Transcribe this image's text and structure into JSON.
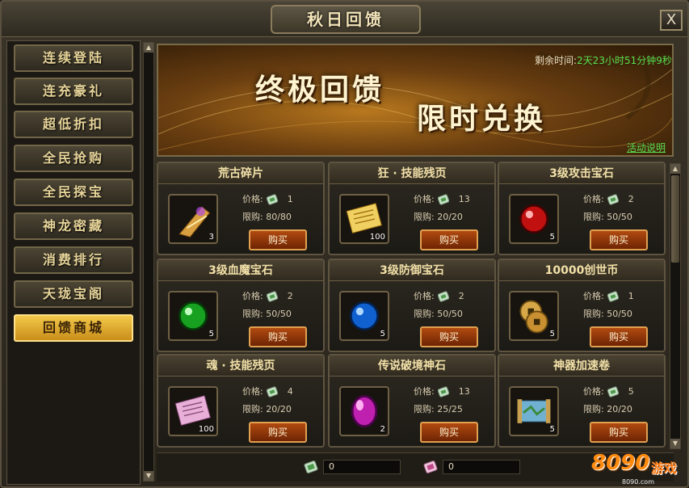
{
  "window": {
    "title": "秋日回馈",
    "close_label": "X"
  },
  "sidebar": {
    "items": [
      {
        "label": "连续登陆",
        "active": false
      },
      {
        "label": "连充豪礼",
        "active": false
      },
      {
        "label": "超低折扣",
        "active": false
      },
      {
        "label": "全民抢购",
        "active": false
      },
      {
        "label": "全民探宝",
        "active": false
      },
      {
        "label": "神龙密藏",
        "active": false
      },
      {
        "label": "消费排行",
        "active": false
      },
      {
        "label": "天珑宝阁",
        "active": false
      },
      {
        "label": "回馈商城",
        "active": true
      }
    ]
  },
  "banner": {
    "title_1": "终极回馈",
    "title_2": "限时兑换",
    "timer_label": "剩余时间:",
    "timer_value": "2天23小时51分钟9秒",
    "link": "活动说明"
  },
  "shop": {
    "price_label": "价格:",
    "limit_label": "限购:",
    "buy_label": "购买",
    "items": [
      {
        "name": "荒古碎片",
        "price": "1",
        "limit": "80/80",
        "count": "3",
        "icon": "fragment-icon"
      },
      {
        "name": "狂 · 技能残页",
        "price": "13",
        "limit": "20/20",
        "count": "100",
        "icon": "scroll-page-icon"
      },
      {
        "name": "3级攻击宝石",
        "price": "2",
        "limit": "50/50",
        "count": "5",
        "icon": "red-gem-icon"
      },
      {
        "name": "3级血魔宝石",
        "price": "2",
        "limit": "50/50",
        "count": "5",
        "icon": "green-gem-icon"
      },
      {
        "name": "3级防御宝石",
        "price": "2",
        "limit": "50/50",
        "count": "5",
        "icon": "blue-gem-icon"
      },
      {
        "name": "10000创世币",
        "price": "1",
        "limit": "50/50",
        "count": "5",
        "icon": "coin-icon"
      },
      {
        "name": "魂 · 技能残页",
        "price": "4",
        "limit": "20/20",
        "count": "100",
        "icon": "pink-scroll-page-icon"
      },
      {
        "name": "传说破境神石",
        "price": "13",
        "limit": "25/25",
        "count": "2",
        "icon": "purple-stone-icon"
      },
      {
        "name": "神器加速卷",
        "price": "5",
        "limit": "20/20",
        "count": "5",
        "icon": "map-scroll-icon"
      }
    ]
  },
  "balances": [
    {
      "value": "0",
      "icon": "green-ticket-icon"
    },
    {
      "value": "0",
      "icon": "pink-ticket-icon"
    }
  ],
  "logo": {
    "text": "8090",
    "cn": "游戏",
    "url": "8090.com"
  },
  "colors": {
    "accent": "#f2c84a",
    "timer": "#58e050",
    "buy": "#b04a10"
  }
}
